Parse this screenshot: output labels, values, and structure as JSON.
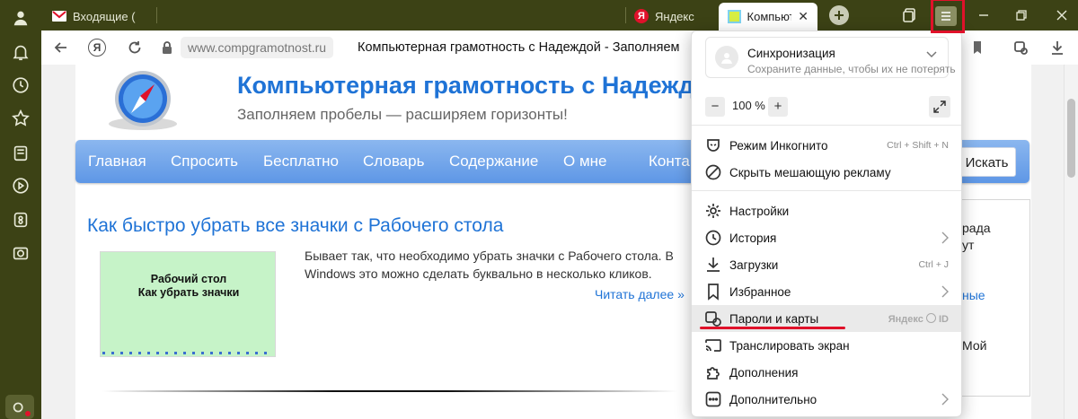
{
  "tabs": [
    {
      "label": "Входящие (",
      "icon": "gmail-icon"
    },
    {
      "label": "Яндекс",
      "icon": "yandex-icon"
    },
    {
      "label": "Компьют",
      "icon": "site-favicon"
    }
  ],
  "toolbar": {
    "yandex_btn": "Я",
    "url_host": "www.compgramotnost.ru",
    "page_title": "Компьютерная грамотность с Надеждой - Заполняем"
  },
  "site": {
    "title": "Компьютерная грамотность с Надеждо",
    "subtitle": "Заполняем пробелы — расширяем горизонты!",
    "nav": [
      "Главная",
      "Спросить",
      "Бесплатно",
      "Словарь",
      "Содержание",
      "О мне",
      "Конта"
    ],
    "search_label": "Искать",
    "post_title": "Как быстро убрать все значки с Рабочего стола",
    "thumb_line1": "Рабочий стол",
    "thumb_line2": "Как убрать значки",
    "excerpt": "Бывает так, что необходимо убрать значки с Рабочего стола. В Windows это можно сделать буквально в несколько кликов.",
    "read_more": "Читать далее »",
    "side_frags": [
      "рада",
      "ут",
      "ные",
      "Мой"
    ]
  },
  "menu": {
    "sync_title": "Синхронизация",
    "sync_sub": "Сохраните данные, чтобы их не потерять",
    "zoom_minus": "−",
    "zoom_value": "100 %",
    "zoom_plus": "+",
    "items": [
      {
        "label": "Режим Инкогнито",
        "shortcut": "Ctrl + Shift + N",
        "icon": "incognito-mask-icon"
      },
      {
        "label": "Скрыть мешающую рекламу",
        "shortcut": "",
        "icon": "block-ads-icon"
      },
      {
        "label": "Настройки",
        "shortcut": "",
        "icon": "gear-icon"
      },
      {
        "label": "История",
        "shortcut": "",
        "icon": "history-clock-icon"
      },
      {
        "label": "Загрузки",
        "shortcut": "Ctrl + J",
        "icon": "download-icon"
      },
      {
        "label": "Избранное",
        "shortcut": "",
        "icon": "bookmark-icon"
      },
      {
        "label": "Пароли и карты",
        "shortcut": "Яндекс",
        "shortcut2": "ID",
        "icon": "passwords-cards-icon"
      },
      {
        "label": "Транслировать экран",
        "shortcut": "",
        "icon": "cast-screen-icon"
      },
      {
        "label": "Дополнения",
        "shortcut": "",
        "icon": "puzzle-icon"
      },
      {
        "label": "Дополнительно",
        "shortcut": "",
        "icon": "more-dots-icon"
      }
    ]
  },
  "colors": {
    "accent_red": "#e0112a",
    "link_blue": "#1f73d6",
    "frame_olive": "#3c4215"
  }
}
